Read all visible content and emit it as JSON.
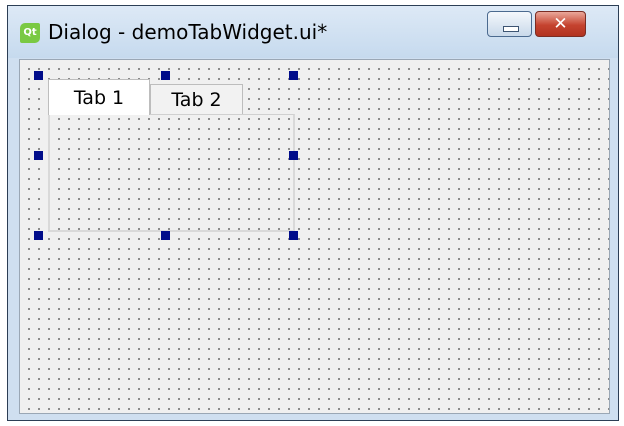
{
  "window": {
    "title": "Dialog - demoTabWidget.ui*",
    "app_icon_text": "Qt",
    "minimize_glyph": "—",
    "close_glyph": "✕",
    "frame_color": "#cfdff0",
    "close_color": "#c5432f"
  },
  "tab_widget": {
    "selected_tab": "Tab 1",
    "tabs": [
      {
        "label": "Tab 1",
        "selected": true
      },
      {
        "label": "Tab 2",
        "selected": false
      }
    ],
    "selection_handle_color": "#000c8a"
  },
  "form_canvas": {
    "background": "#f0f0f0",
    "grid": "dotted"
  }
}
